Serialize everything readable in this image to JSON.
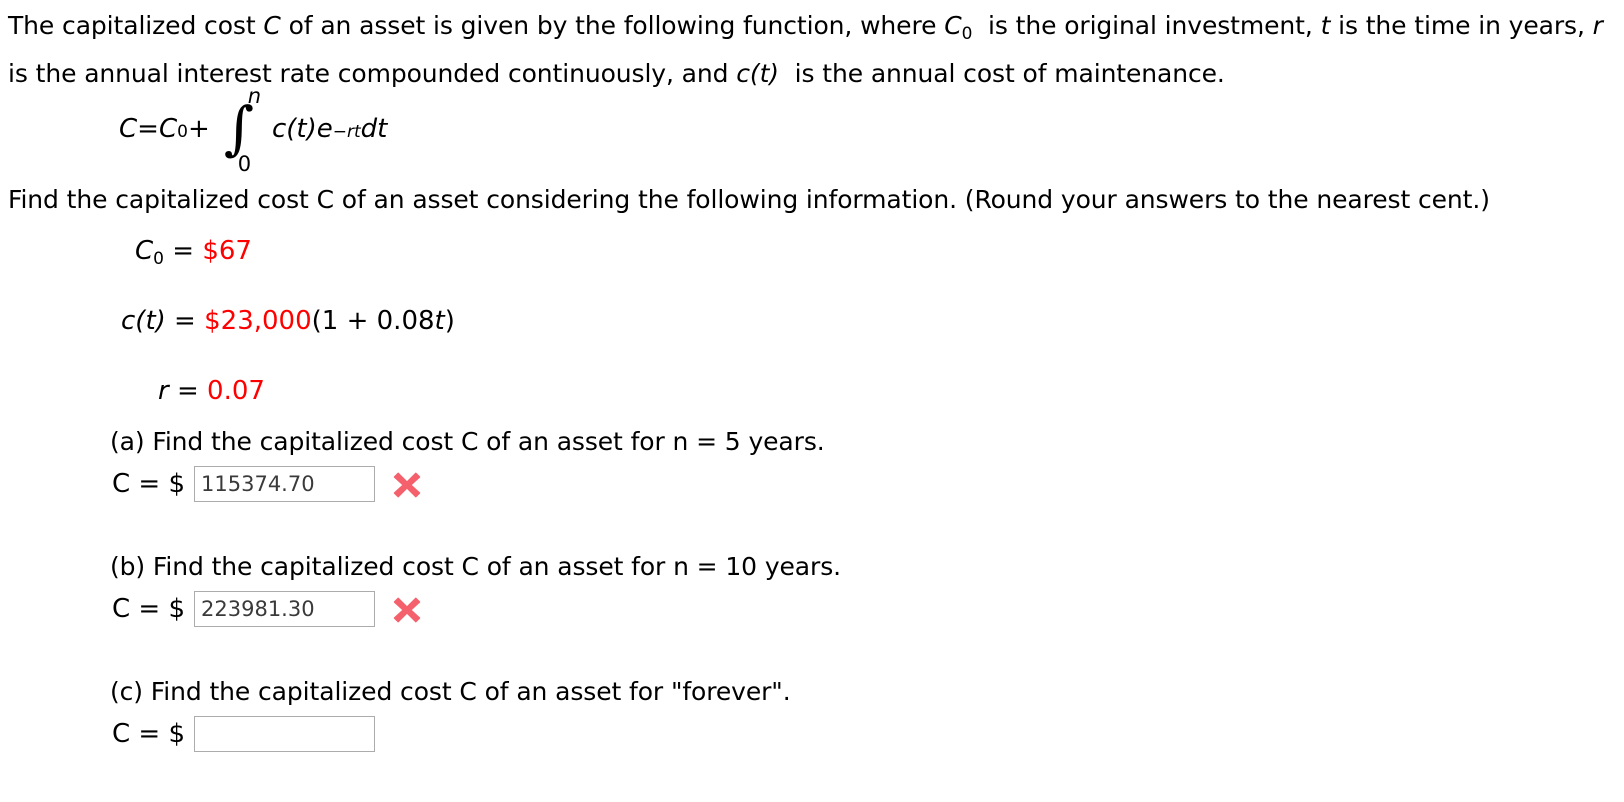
{
  "problem": {
    "intro_part1": "The capitalized cost ",
    "intro_C": "C",
    "intro_part2": " of an asset is given by the following function, where ",
    "intro_C0": "C",
    "intro_C0_sub": "0",
    "intro_part3": " is the original investment, ",
    "intro_t": "t",
    "intro_part4": " is the time in years, ",
    "intro_r": "r",
    "intro_part5": " is the annual interest rate compounded continuously, and ",
    "intro_ct": "c(t)",
    "intro_part6": " is the annual cost of maintenance."
  },
  "formula": {
    "lhs_C": "C",
    "equals": " = ",
    "C0_base": "C",
    "C0_sub": "0",
    "plus": " + ",
    "integral_sign": "∫",
    "upper_limit": "n",
    "lower_limit": "0",
    "integrand_ct": "c(t)e",
    "exponent": "−rt",
    "differential": " dt"
  },
  "find_line": "Find the capitalized cost C of an asset considering the following information. (Round your answers to the nearest cent.)",
  "given": [
    {
      "name": "initial-investment",
      "label_base": "C",
      "label_sub": "0",
      "equals": " = ",
      "value_red": "$67",
      "value_black": ""
    },
    {
      "name": "maintenance-cost-function",
      "label_base": "c(t)",
      "label_sub": "",
      "equals": " = ",
      "value_red": "$23,000",
      "value_black": "(1 + 0.08t)"
    },
    {
      "name": "interest-rate",
      "label_base": "r",
      "label_sub": "",
      "equals": " = ",
      "value_red": "0.07",
      "value_black": ""
    }
  ],
  "parts": [
    {
      "id": "a",
      "prompt": "(a) Find the capitalized cost C of an asset for  n = 5  years.",
      "answer_label": "C = $",
      "answer_value": "115374.70",
      "answer_placeholder": "",
      "status": "incorrect",
      "status_icon": "x-mark-icon"
    },
    {
      "id": "b",
      "prompt": "(b) Find the capitalized cost C of an asset for  n = 10  years.",
      "answer_label": "C = $",
      "answer_value": "223981.30",
      "answer_placeholder": "",
      "status": "incorrect",
      "status_icon": "x-mark-icon"
    },
    {
      "id": "c",
      "prompt": "(c) Find the capitalized cost C of an asset for \"forever\".",
      "answer_label": "C = $",
      "answer_value": "",
      "answer_placeholder": "",
      "status": "unanswered",
      "status_icon": ""
    }
  ],
  "colors": {
    "given_value": "#ff0000",
    "incorrect_mark": "#f4616d",
    "input_border": "#acacac",
    "input_text": "#3a3a3a",
    "body_text": "#000000"
  }
}
